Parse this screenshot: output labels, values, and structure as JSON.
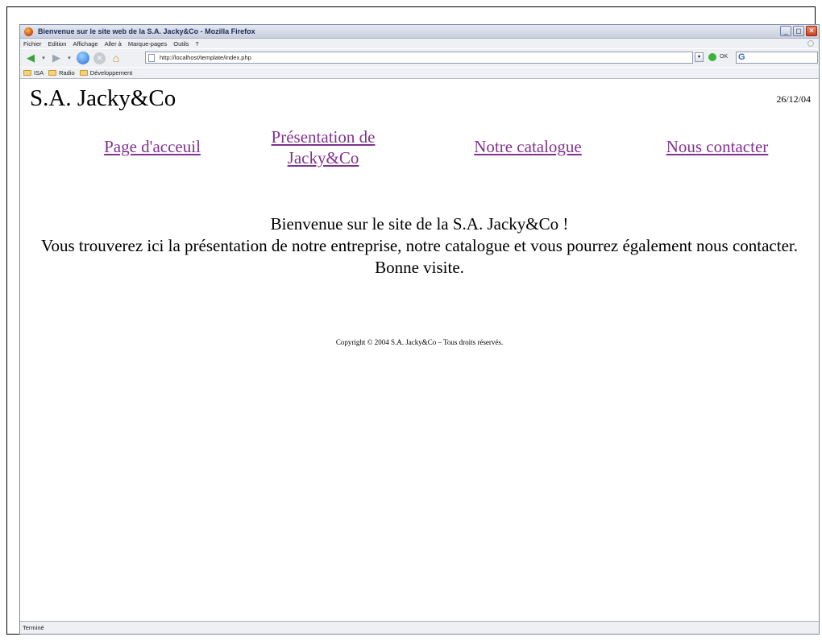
{
  "window": {
    "title": "Bienvenue sur le site web de la S.A. Jacky&Co - Mozilla Firefox"
  },
  "menu": {
    "items": [
      "Fichier",
      "Edition",
      "Affichage",
      "Aller à",
      "Marque-pages",
      "Outils",
      "?"
    ]
  },
  "toolbar": {
    "url": "http://localhost/template/index.php",
    "go_label": "OK"
  },
  "bookmarks": {
    "items": [
      "ISA",
      "Radio",
      "Développement"
    ]
  },
  "page": {
    "site_title": "S.A. Jacky&Co",
    "date": "26/12/04",
    "nav": {
      "home": "Page d'acceuil",
      "presentation": "Présentation de Jacky&Co",
      "catalogue": "Notre catalogue",
      "contact": "Nous contacter"
    },
    "welcome": {
      "line1": "Bienvenue sur le site de la S.A. Jacky&Co !",
      "line2": "Vous trouverez ici la présentation de notre entreprise, notre catalogue et vous pourrez également nous contacter.",
      "line3": "Bonne visite."
    },
    "copyright": "Copyright © 2004 S.A. Jacky&Co – Tous droits réservés."
  },
  "status": {
    "text": "Terminé"
  }
}
